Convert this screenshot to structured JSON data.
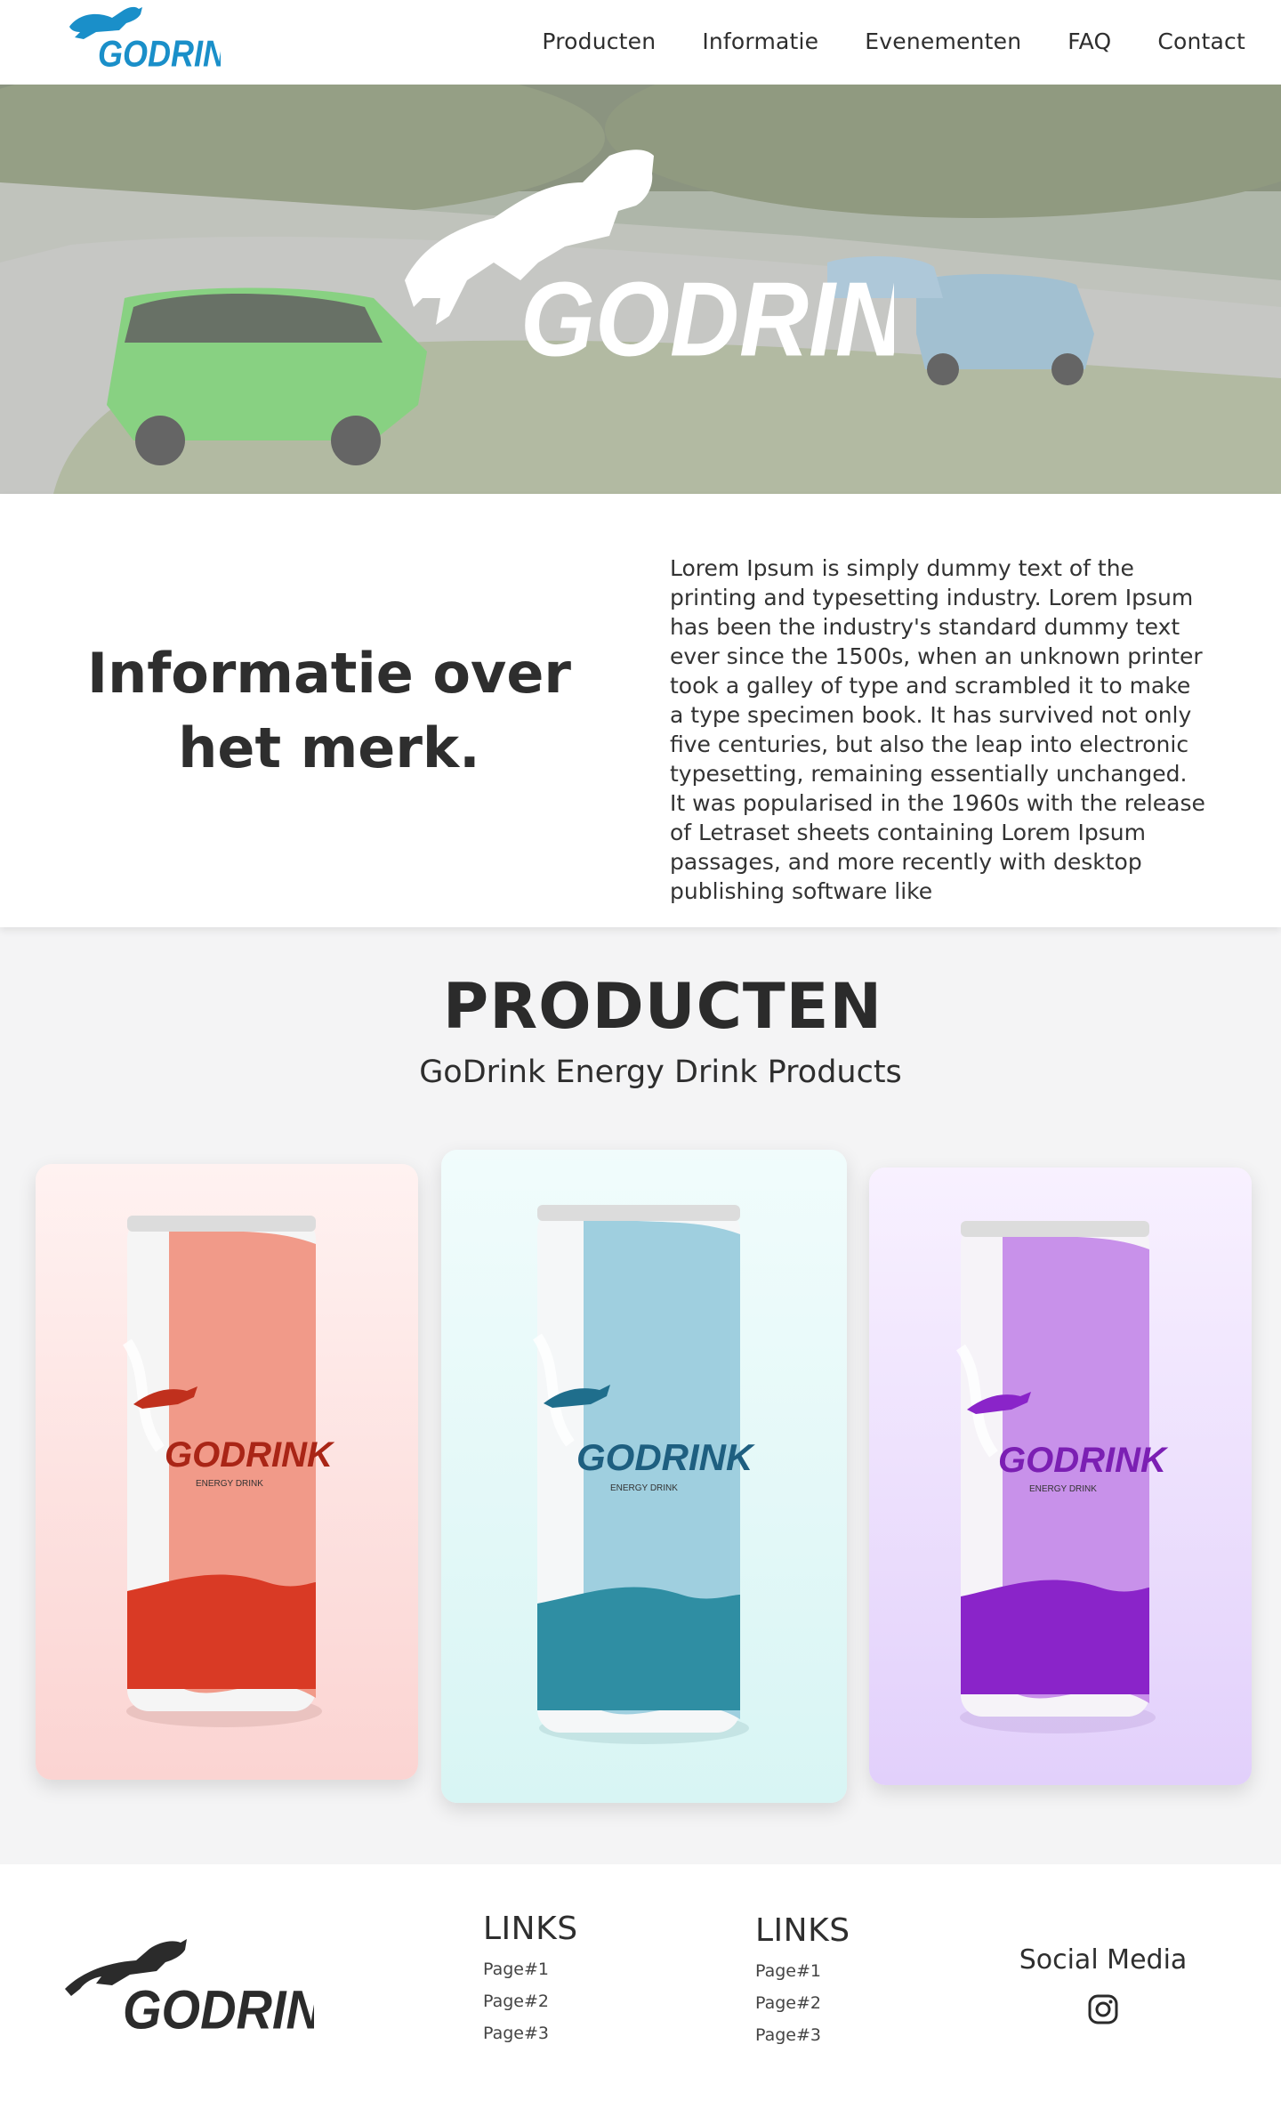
{
  "nav": {
    "brand": "GODRINK",
    "items": [
      {
        "label": "Producten"
      },
      {
        "label": "Informatie"
      },
      {
        "label": "Evenementen"
      },
      {
        "label": "FAQ"
      },
      {
        "label": "Contact"
      }
    ]
  },
  "hero": {
    "brand": "GODRINK"
  },
  "info": {
    "title_line1": "Informatie over",
    "title_line2": "het merk.",
    "body": "Lorem Ipsum is simply dummy text of the printing and typesetting industry. Lorem Ipsum has been the industry's standard dummy text ever since the 1500s, when an unknown printer took a galley of type and scrambled it to make a type specimen book. It has survived not only five centuries, but also the leap into electronic typesetting, remaining essentially unchanged. It was popularised in the 1960s with the release of Letraset sheets containing Lorem Ipsum passages, and more recently with desktop publishing software like"
  },
  "products": {
    "title": "PRODUCTEN",
    "subtitle": "GoDrink Energy Drink Products",
    "items": [
      {
        "brand": "GODRINK",
        "tagline": "ENERGY DRINK",
        "color": "#e8533f"
      },
      {
        "brand": "GODRINK",
        "tagline": "ENERGY DRINK",
        "color": "#2b8fa8"
      },
      {
        "brand": "GODRINK",
        "tagline": "ENERGY DRINK",
        "color": "#9b2fd6"
      }
    ]
  },
  "footer": {
    "brand": "GODRINK",
    "col1": {
      "title": "LINKS",
      "links": [
        "Page#1",
        "Page#2",
        "Page#3"
      ]
    },
    "col2": {
      "title": "LINKS",
      "links": [
        "Page#1",
        "Page#2",
        "Page#3"
      ]
    },
    "social_label": "Social Media"
  },
  "colors": {
    "brand_blue": "#1a8fc9",
    "dark_text": "#2b2b2b"
  }
}
